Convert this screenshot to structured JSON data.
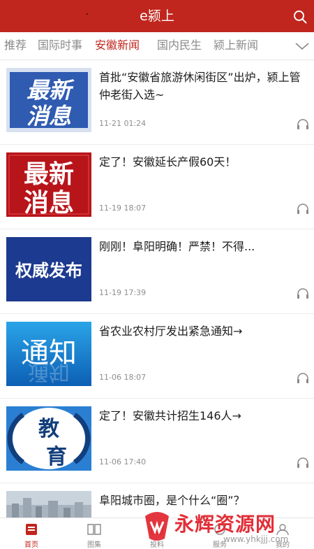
{
  "header": {
    "title": "e颍上"
  },
  "tabs": [
    "推荐",
    "国际时事",
    "安徽新闻",
    "国内民生",
    "颍上新闻"
  ],
  "active_tab": "安徽新闻",
  "news": [
    {
      "headline": "首批“安徽省旅游休闲街区”出炉，颍上管仲老街入选~",
      "time": "11-21 01:24",
      "thumb_text": "最新消息",
      "thumb_style": "blue-box"
    },
    {
      "headline": "定了！安徽延长产假60天！",
      "time": "11-19 18:07",
      "thumb_text": "最新消息",
      "thumb_style": "red-box"
    },
    {
      "headline": "刚刚！阜阳明确！严禁！不得...",
      "time": "11-19 17:39",
      "thumb_text": "权威发布",
      "thumb_style": "navy"
    },
    {
      "headline": "省农业农村厅发出紧急通知→",
      "time": "11-06 18:07",
      "thumb_text": "通知",
      "thumb_style": "blue-gradient"
    },
    {
      "headline": "定了！安徽共计招生146人→",
      "time": "11-06 17:40",
      "thumb_text": "教育",
      "thumb_style": "edu"
    },
    {
      "headline": "阜阳城市圈，是个什么“圈”？",
      "time": "",
      "thumb_text": "",
      "thumb_style": "city"
    }
  ],
  "bottom_nav": [
    {
      "label": "首页",
      "icon": "home-icon"
    },
    {
      "label": "图集",
      "icon": "gallery-icon"
    },
    {
      "label": "投料",
      "icon": "submit-icon"
    },
    {
      "label": "服务",
      "icon": "service-icon"
    },
    {
      "label": "我的",
      "icon": "profile-icon"
    }
  ],
  "active_nav": "首页",
  "watermark": {
    "name": "永辉资源网",
    "url": "www.yhkjjj.com"
  },
  "colors": {
    "brand": "#c0261d",
    "tab_inactive": "#8a8a8a",
    "time": "#8e8e8e"
  }
}
